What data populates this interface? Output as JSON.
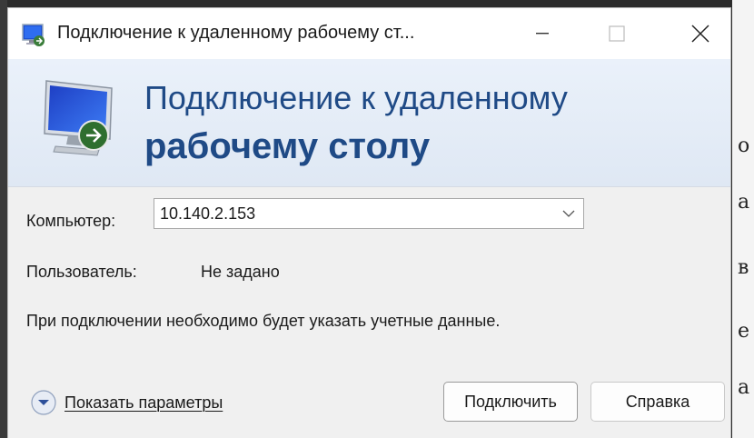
{
  "window": {
    "title": "Подключение к удаленному рабочему ст...",
    "minimize_icon": "minimize-icon",
    "maximize_icon": "maximize-icon",
    "close_icon": "close-icon"
  },
  "banner": {
    "line1": "Подключение к удаленному",
    "line2": "рабочему столу",
    "icon": "remote-desktop-monitor-icon"
  },
  "form": {
    "computer_label": "Компьютер:",
    "computer_value": "10.140.2.153",
    "user_label": "Пользователь:",
    "user_value": "Не задано",
    "note": "При подключении необходимо будет указать учетные данные."
  },
  "footer": {
    "show_options": "Показать параметры",
    "connect_button": "Подключить",
    "help_button": "Справка"
  },
  "background": {
    "chars": [
      "o",
      "a",
      "в",
      "e",
      "a"
    ]
  },
  "colors": {
    "banner_text": "#1f4a86",
    "dialog_bg": "#f0f0f0"
  }
}
